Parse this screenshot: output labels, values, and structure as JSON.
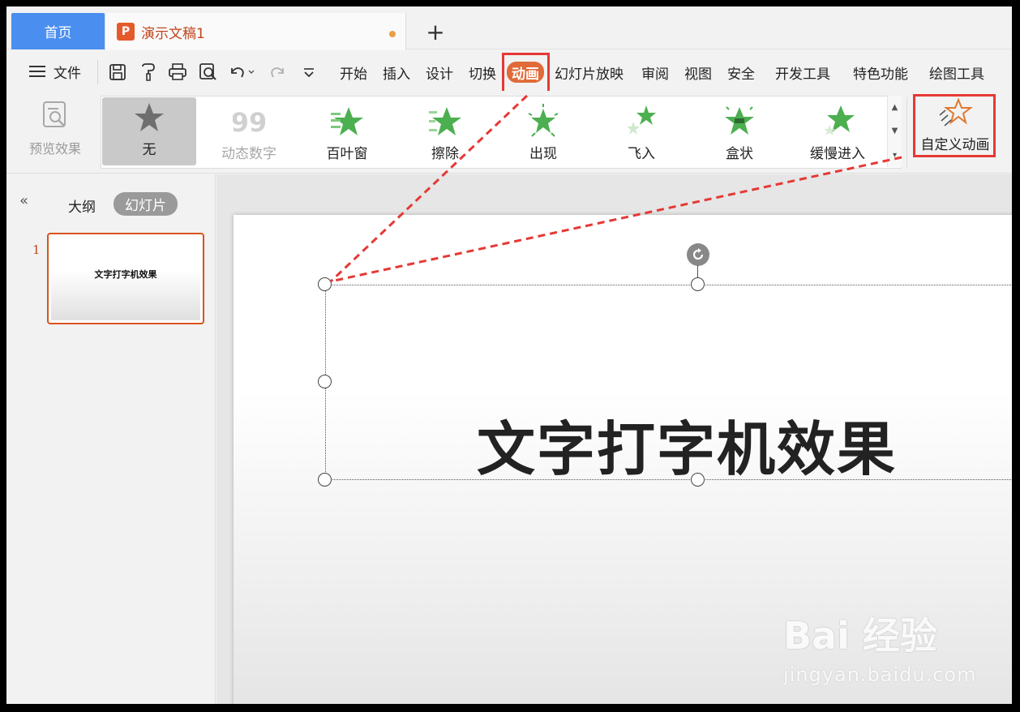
{
  "tabs": {
    "home_label": "首页",
    "doc_icon": "P",
    "doc_title": "演示文稿1",
    "add_label": "+"
  },
  "menu": {
    "file_label": "文件",
    "items": [
      "开始",
      "插入",
      "设计",
      "切换",
      "动画",
      "幻灯片放映",
      "审阅",
      "视图",
      "安全",
      "开发工具",
      "特色功能",
      "绘图工具"
    ],
    "active": "动画",
    "quick_access_icons": [
      "save-icon",
      "format-painter-icon",
      "print-icon",
      "print-preview-icon",
      "undo-icon",
      "redo-icon",
      "customize-dropdown-icon"
    ]
  },
  "ribbon": {
    "preview_label": "预览效果",
    "effects": [
      "无",
      "动态数字",
      "百叶窗",
      "擦除",
      "出现",
      "飞入",
      "盒状",
      "缓慢进入"
    ],
    "selected_effect": "无",
    "disabled_effect": "动态数字",
    "custom_animation_label": "自定义动画"
  },
  "left_panel": {
    "outline_label": "大纲",
    "slides_label": "幻灯片",
    "slide_number": "1",
    "thumb_text": "文字打字机效果"
  },
  "slide": {
    "title": "文字打字机效果"
  },
  "watermark": {
    "brand": "Bai 经验",
    "url": "jingyan.baidu.com"
  },
  "colors": {
    "accent": "#4a8ef0",
    "animation_tab": "#e06a38",
    "annotation_red": "#e53935",
    "effect_star_green": "#4caf50"
  }
}
